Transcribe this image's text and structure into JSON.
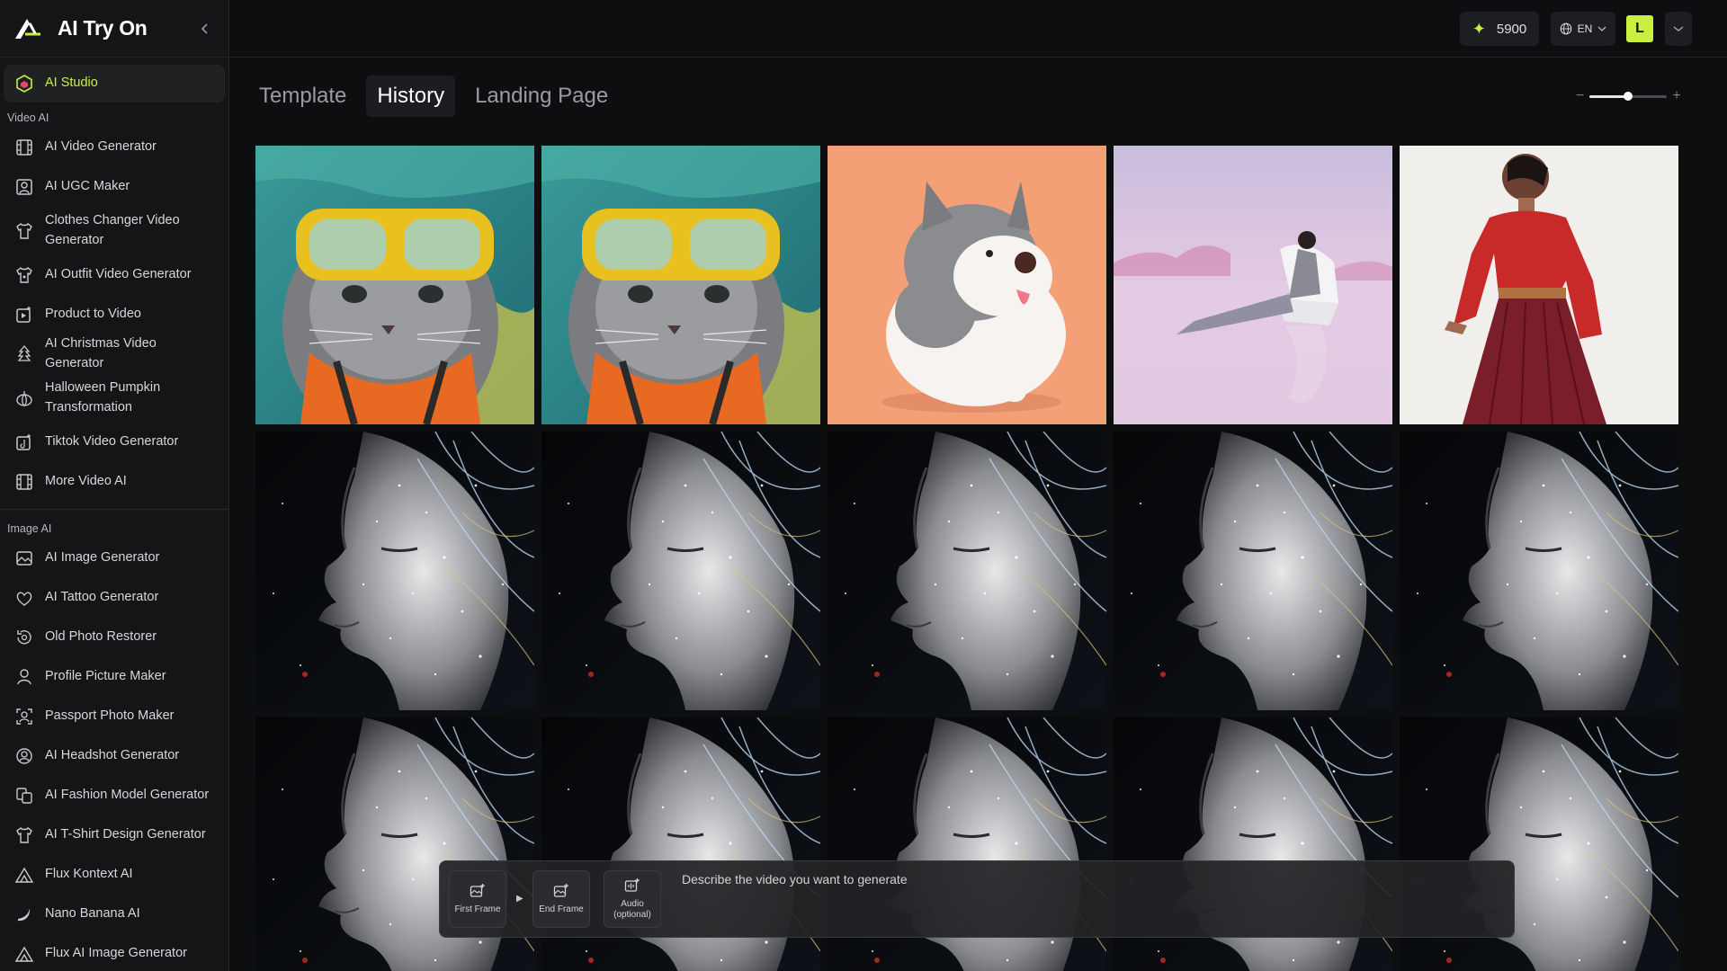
{
  "app": {
    "title": "AI Try On",
    "collapse_icon": "chevron-left-icon"
  },
  "sidebar": {
    "active_item": {
      "label": "AI Studio",
      "icon": "cube-icon"
    },
    "sections": [
      {
        "label": "Video AI",
        "items": [
          {
            "label": "AI Video Generator",
            "icon": "film-icon"
          },
          {
            "label": "AI UGC Maker",
            "icon": "ugc-icon"
          },
          {
            "label": "Clothes Changer Video Generator",
            "icon": "shirt-swap-icon"
          },
          {
            "label": "AI Outfit Video Generator",
            "icon": "outfit-icon"
          },
          {
            "label": "Product to Video",
            "icon": "product-video-icon"
          },
          {
            "label": "AI Christmas Video Generator",
            "icon": "tree-icon"
          },
          {
            "label": "Halloween Pumpkin Transformation",
            "icon": "pumpkin-icon"
          },
          {
            "label": "Tiktok Video Generator",
            "icon": "tiktok-icon"
          },
          {
            "label": "More Video AI",
            "icon": "film-icon"
          }
        ]
      },
      {
        "label": "Image AI",
        "items": [
          {
            "label": "AI Image Generator",
            "icon": "image-icon"
          },
          {
            "label": "AI Tattoo Generator",
            "icon": "tattoo-icon"
          },
          {
            "label": "Old Photo Restorer",
            "icon": "restore-icon"
          },
          {
            "label": "Profile Picture Maker",
            "icon": "person-icon"
          },
          {
            "label": "Passport Photo Maker",
            "icon": "passport-icon"
          },
          {
            "label": "AI Headshot Generator",
            "icon": "headshot-icon"
          },
          {
            "label": "AI Fashion Model Generator",
            "icon": "fashion-icon"
          },
          {
            "label": "AI T-Shirt Design Generator",
            "icon": "tshirt-icon"
          },
          {
            "label": "Flux Kontext AI",
            "icon": "flux-icon"
          },
          {
            "label": "Nano Banana AI",
            "icon": "banana-icon"
          },
          {
            "label": "Flux AI Image Generator",
            "icon": "flux-icon"
          }
        ]
      }
    ]
  },
  "topbar": {
    "credits": "5900",
    "language": "EN",
    "avatar_initial": "L"
  },
  "tabs": [
    {
      "label": "Template",
      "active": false
    },
    {
      "label": "History",
      "active": true
    },
    {
      "label": "Landing Page",
      "active": false
    }
  ],
  "zoom": {
    "minus": "−",
    "plus": "+",
    "level": 0.5
  },
  "gallery": [
    {
      "subject": "cat-snorkel"
    },
    {
      "subject": "cat-snorkel"
    },
    {
      "subject": "husky-toy"
    },
    {
      "subject": "woman-chair-lake"
    },
    {
      "subject": "woman-red-sweater"
    },
    {
      "subject": "sparkle-face"
    },
    {
      "subject": "sparkle-face"
    },
    {
      "subject": "sparkle-face"
    },
    {
      "subject": "sparkle-face"
    },
    {
      "subject": "sparkle-face"
    },
    {
      "subject": "sparkle-face"
    },
    {
      "subject": "sparkle-face"
    },
    {
      "subject": "sparkle-face"
    },
    {
      "subject": "sparkle-face"
    },
    {
      "subject": "sparkle-face"
    }
  ],
  "prompt": {
    "first_frame": "First Frame",
    "end_frame": "End Frame",
    "audio_label": "Audio",
    "audio_sub": "(optional)",
    "placeholder": "Describe the video you want to generate"
  },
  "colors": {
    "accent": "#c8f040",
    "background": "#0d0e10",
    "sidebar": "#141517"
  }
}
